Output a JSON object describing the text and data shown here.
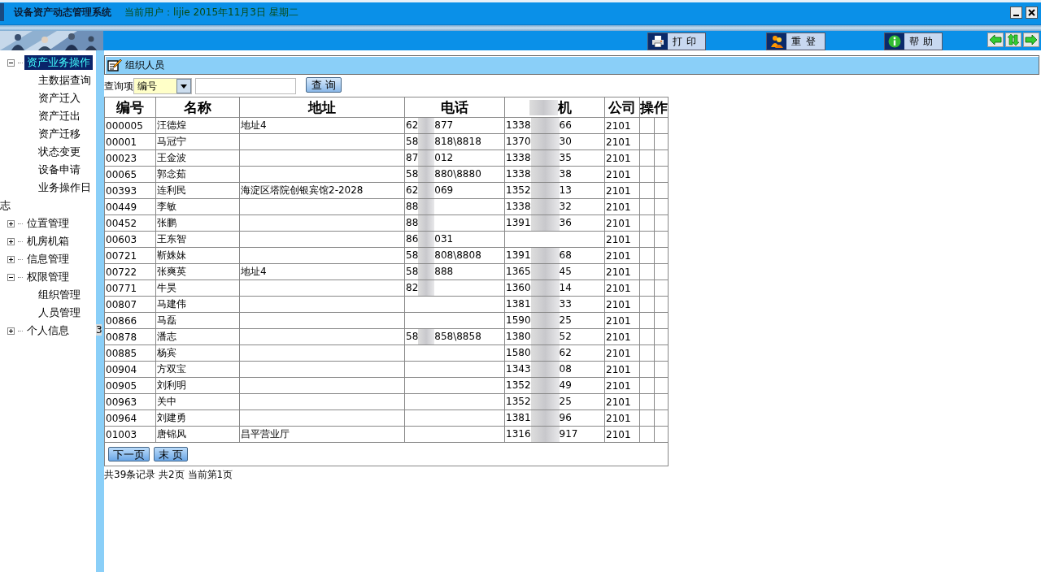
{
  "window": {
    "title": "设备资产动态管理系统",
    "user_info": "当前用户：lijie 2015年11月3日 星期二"
  },
  "toolbar": {
    "buttons": [
      {
        "kind": "print",
        "label": "打 印"
      },
      {
        "kind": "relogin",
        "label": "重 登"
      },
      {
        "kind": "help",
        "label": "帮 助"
      }
    ]
  },
  "sidebar": {
    "items": [
      {
        "label": "资产业务操作",
        "expanded": true,
        "selected": true,
        "children": [
          {
            "label": "主数据查询",
            "selected": false
          },
          {
            "label": "资产迁入",
            "selected": false
          },
          {
            "label": "资产迁出",
            "selected": false
          },
          {
            "label": "资产迁移",
            "selected": false
          },
          {
            "label": "状态变更",
            "selected": false
          },
          {
            "label": "设备申请",
            "selected": false
          },
          {
            "label": "业务操作日志",
            "selected": false
          }
        ]
      },
      {
        "label": "位置管理",
        "expanded": false,
        "selected": false
      },
      {
        "label": "机房机箱",
        "expanded": false,
        "selected": false
      },
      {
        "label": "信息管理",
        "expanded": false,
        "selected": false
      },
      {
        "label": "权限管理",
        "expanded": true,
        "selected": false,
        "children": [
          {
            "label": "组织管理",
            "selected": false
          },
          {
            "label": "人员管理",
            "selected": false
          }
        ]
      },
      {
        "label": "个人信息",
        "expanded": false,
        "selected": false
      }
    ]
  },
  "splitter_label": "3",
  "panel": {
    "title": "组织人员",
    "search": {
      "label": "查询项",
      "field": "编号",
      "button": "查 询"
    }
  },
  "table": {
    "columns": [
      "编号",
      "名称",
      "地址",
      "电话",
      "机",
      "公司",
      "操作"
    ],
    "rows": [
      {
        "id": "000005",
        "name": "汪德煌",
        "address": "地址4",
        "phone_start": "62",
        "phone_end": "877",
        "mobile_start": "1338",
        "mobile_end": "66",
        "company": "2101"
      },
      {
        "id": "00001",
        "name": "马冠宁",
        "phone_start": "58",
        "phone_end": "818\\8818",
        "mobile_start": "1370",
        "mobile_end": "30",
        "company": "2101"
      },
      {
        "id": "00023",
        "name": "王金波",
        "phone_start": "87",
        "phone_end": "012",
        "mobile_start": "1338",
        "mobile_end": "35",
        "company": "2101"
      },
      {
        "id": "00065",
        "name": "郭念茹",
        "phone_start": "58",
        "phone_end": "880\\8880",
        "mobile_start": "1338",
        "mobile_end": "38",
        "company": "2101"
      },
      {
        "id": "00393",
        "name": "连利民",
        "address": "海淀区塔院创银宾馆2-2028",
        "phone_start": "62",
        "phone_end": "069",
        "mobile_start": "1352",
        "mobile_end": "13",
        "company": "2101"
      },
      {
        "id": "00449",
        "name": "李敏",
        "phone_start": "88",
        "mobile_start": "1338",
        "mobile_end": "32",
        "company": "2101"
      },
      {
        "id": "00452",
        "name": "张鹏",
        "phone_start": "88",
        "mobile_start": "1391",
        "mobile_end": "36",
        "company": "2101"
      },
      {
        "id": "00603",
        "name": "王东智",
        "phone_start": "86",
        "phone_end": "031",
        "company": "2101"
      },
      {
        "id": "00721",
        "name": "靳姝妹",
        "phone_start": "58",
        "phone_end": "808\\8808",
        "mobile_start": "1391",
        "mobile_end": "68",
        "company": "2101"
      },
      {
        "id": "00722",
        "name": "张爽英",
        "address": "地址4",
        "phone_start": "58",
        "phone_end": "888",
        "mobile_start": "1365",
        "mobile_end": "45",
        "company": "2101"
      },
      {
        "id": "00771",
        "name": "牛昊",
        "phone_start": "82",
        "mobile_start": "1360",
        "mobile_end": "14",
        "company": "2101"
      },
      {
        "id": "00807",
        "name": "马建伟",
        "mobile_start": "1381",
        "mobile_end": "33",
        "company": "2101"
      },
      {
        "id": "00866",
        "name": "马磊",
        "mobile_start": "1590",
        "mobile_end": "25",
        "company": "2101"
      },
      {
        "id": "00878",
        "name": "潘志",
        "phone_start": "58",
        "phone_end": "858\\8858",
        "mobile_start": "1380",
        "mobile_end": "52",
        "company": "2101"
      },
      {
        "id": "00885",
        "name": "杨宾",
        "mobile_start": "1580",
        "mobile_end": "62",
        "company": "2101"
      },
      {
        "id": "00904",
        "name": "方双宝",
        "mobile_start": "1343",
        "mobile_end": "08",
        "company": "2101"
      },
      {
        "id": "00905",
        "name": "刘利明",
        "mobile_start": "1352",
        "mobile_end": "49",
        "company": "2101"
      },
      {
        "id": "00963",
        "name": "关中",
        "mobile_start": "1352",
        "mobile_end": "25",
        "company": "2101"
      },
      {
        "id": "00964",
        "name": "刘建勇",
        "mobile_start": "1381",
        "mobile_end": "96",
        "company": "2101"
      },
      {
        "id": "01003",
        "name": "唐锦风",
        "address": "昌平营业厅",
        "mobile_start": "1316",
        "mobile_end": "917",
        "company": "2101"
      }
    ]
  },
  "pager": {
    "buttons": [
      "下一页",
      "末 页"
    ],
    "summary": "共39条记录 共2页 当前第1页"
  }
}
